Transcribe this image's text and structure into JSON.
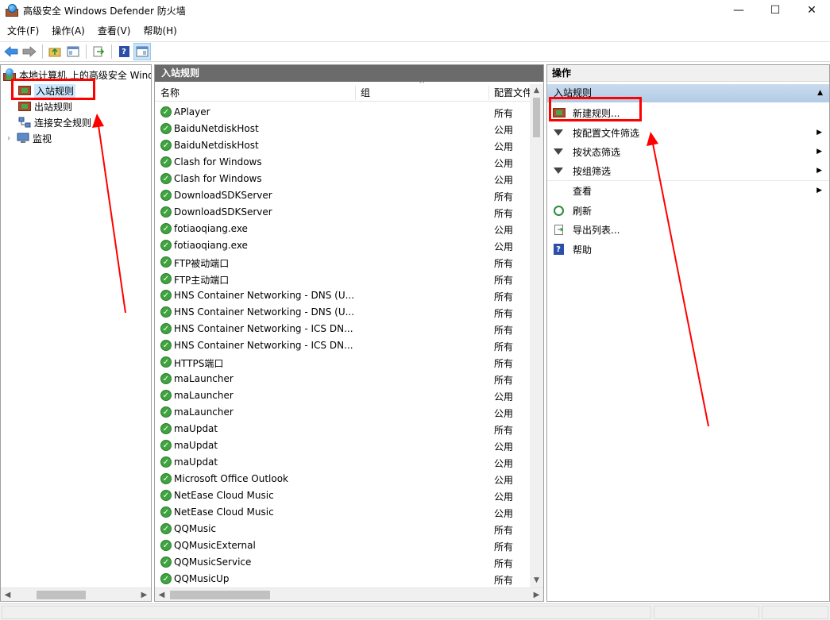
{
  "window": {
    "title": "高级安全 Windows Defender 防火墙",
    "controls": {
      "minimize": "—",
      "maximize": "☐",
      "close": "✕"
    }
  },
  "menu": [
    "文件(F)",
    "操作(A)",
    "查看(V)",
    "帮助(H)"
  ],
  "tree": {
    "root": "本地计算机 上的高级安全 Windows Defender 防火墙",
    "items": [
      {
        "label": "入站规则",
        "selected": true
      },
      {
        "label": "出站规则",
        "selected": false
      },
      {
        "label": "连接安全规则",
        "selected": false
      },
      {
        "label": "监视",
        "selected": false,
        "expandable": true
      }
    ]
  },
  "middle": {
    "header": "入站规则",
    "columns": {
      "name": "名称",
      "group": "组",
      "profile": "配置文件"
    },
    "rules": [
      {
        "name": "APlayer",
        "profile": "所有"
      },
      {
        "name": "BaiduNetdiskHost",
        "profile": "公用"
      },
      {
        "name": "BaiduNetdiskHost",
        "profile": "公用"
      },
      {
        "name": "Clash for Windows",
        "profile": "公用"
      },
      {
        "name": "Clash for Windows",
        "profile": "公用"
      },
      {
        "name": "DownloadSDKServer",
        "profile": "所有"
      },
      {
        "name": "DownloadSDKServer",
        "profile": "所有"
      },
      {
        "name": "fotiaoqiang.exe",
        "profile": "公用"
      },
      {
        "name": "fotiaoqiang.exe",
        "profile": "公用"
      },
      {
        "name": "FTP被动端口",
        "profile": "所有"
      },
      {
        "name": "FTP主动端口",
        "profile": "所有"
      },
      {
        "name": "HNS Container Networking - DNS (U...",
        "profile": "所有"
      },
      {
        "name": "HNS Container Networking - DNS (U...",
        "profile": "所有"
      },
      {
        "name": "HNS Container Networking - ICS DN...",
        "profile": "所有"
      },
      {
        "name": "HNS Container Networking - ICS DN...",
        "profile": "所有"
      },
      {
        "name": "HTTPS端口",
        "profile": "所有"
      },
      {
        "name": "maLauncher",
        "profile": "所有"
      },
      {
        "name": "maLauncher",
        "profile": "公用"
      },
      {
        "name": "maLauncher",
        "profile": "公用"
      },
      {
        "name": "maUpdat",
        "profile": "所有"
      },
      {
        "name": "maUpdat",
        "profile": "公用"
      },
      {
        "name": "maUpdat",
        "profile": "公用"
      },
      {
        "name": "Microsoft Office Outlook",
        "profile": "公用"
      },
      {
        "name": "NetEase Cloud Music",
        "profile": "公用"
      },
      {
        "name": "NetEase Cloud Music",
        "profile": "公用"
      },
      {
        "name": "QQMusic",
        "profile": "所有"
      },
      {
        "name": "QQMusicExternal",
        "profile": "所有"
      },
      {
        "name": "QQMusicService",
        "profile": "所有"
      },
      {
        "name": "QQMusicUp",
        "profile": "所有"
      }
    ]
  },
  "actions": {
    "title": "操作",
    "section": "入站规则",
    "items": [
      {
        "label": "新建规则...",
        "icon": "new-rule-icon",
        "submenu": false
      },
      {
        "label": "按配置文件筛选",
        "icon": "filter-icon",
        "submenu": true
      },
      {
        "label": "按状态筛选",
        "icon": "filter-icon",
        "submenu": true
      },
      {
        "label": "按组筛选",
        "icon": "filter-icon",
        "submenu": true
      },
      {
        "label": "查看",
        "icon": "",
        "submenu": true
      },
      {
        "label": "刷新",
        "icon": "refresh-icon",
        "submenu": false
      },
      {
        "label": "导出列表...",
        "icon": "export-icon",
        "submenu": false
      },
      {
        "label": "帮助",
        "icon": "help-icon",
        "submenu": false
      }
    ]
  },
  "annotation_color": "#ff0000"
}
